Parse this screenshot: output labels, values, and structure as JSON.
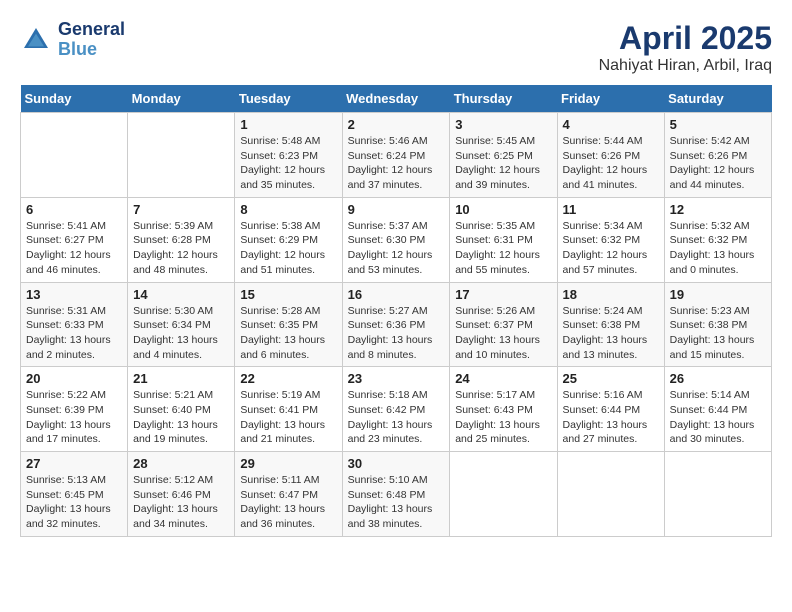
{
  "header": {
    "logo_line1": "General",
    "logo_line2": "Blue",
    "title": "April 2025",
    "subtitle": "Nahiyat Hiran, Arbil, Iraq"
  },
  "weekdays": [
    "Sunday",
    "Monday",
    "Tuesday",
    "Wednesday",
    "Thursday",
    "Friday",
    "Saturday"
  ],
  "weeks": [
    [
      {
        "day": "",
        "info": ""
      },
      {
        "day": "",
        "info": ""
      },
      {
        "day": "1",
        "info": "Sunrise: 5:48 AM\nSunset: 6:23 PM\nDaylight: 12 hours and 35 minutes."
      },
      {
        "day": "2",
        "info": "Sunrise: 5:46 AM\nSunset: 6:24 PM\nDaylight: 12 hours and 37 minutes."
      },
      {
        "day": "3",
        "info": "Sunrise: 5:45 AM\nSunset: 6:25 PM\nDaylight: 12 hours and 39 minutes."
      },
      {
        "day": "4",
        "info": "Sunrise: 5:44 AM\nSunset: 6:26 PM\nDaylight: 12 hours and 41 minutes."
      },
      {
        "day": "5",
        "info": "Sunrise: 5:42 AM\nSunset: 6:26 PM\nDaylight: 12 hours and 44 minutes."
      }
    ],
    [
      {
        "day": "6",
        "info": "Sunrise: 5:41 AM\nSunset: 6:27 PM\nDaylight: 12 hours and 46 minutes."
      },
      {
        "day": "7",
        "info": "Sunrise: 5:39 AM\nSunset: 6:28 PM\nDaylight: 12 hours and 48 minutes."
      },
      {
        "day": "8",
        "info": "Sunrise: 5:38 AM\nSunset: 6:29 PM\nDaylight: 12 hours and 51 minutes."
      },
      {
        "day": "9",
        "info": "Sunrise: 5:37 AM\nSunset: 6:30 PM\nDaylight: 12 hours and 53 minutes."
      },
      {
        "day": "10",
        "info": "Sunrise: 5:35 AM\nSunset: 6:31 PM\nDaylight: 12 hours and 55 minutes."
      },
      {
        "day": "11",
        "info": "Sunrise: 5:34 AM\nSunset: 6:32 PM\nDaylight: 12 hours and 57 minutes."
      },
      {
        "day": "12",
        "info": "Sunrise: 5:32 AM\nSunset: 6:32 PM\nDaylight: 13 hours and 0 minutes."
      }
    ],
    [
      {
        "day": "13",
        "info": "Sunrise: 5:31 AM\nSunset: 6:33 PM\nDaylight: 13 hours and 2 minutes."
      },
      {
        "day": "14",
        "info": "Sunrise: 5:30 AM\nSunset: 6:34 PM\nDaylight: 13 hours and 4 minutes."
      },
      {
        "day": "15",
        "info": "Sunrise: 5:28 AM\nSunset: 6:35 PM\nDaylight: 13 hours and 6 minutes."
      },
      {
        "day": "16",
        "info": "Sunrise: 5:27 AM\nSunset: 6:36 PM\nDaylight: 13 hours and 8 minutes."
      },
      {
        "day": "17",
        "info": "Sunrise: 5:26 AM\nSunset: 6:37 PM\nDaylight: 13 hours and 10 minutes."
      },
      {
        "day": "18",
        "info": "Sunrise: 5:24 AM\nSunset: 6:38 PM\nDaylight: 13 hours and 13 minutes."
      },
      {
        "day": "19",
        "info": "Sunrise: 5:23 AM\nSunset: 6:38 PM\nDaylight: 13 hours and 15 minutes."
      }
    ],
    [
      {
        "day": "20",
        "info": "Sunrise: 5:22 AM\nSunset: 6:39 PM\nDaylight: 13 hours and 17 minutes."
      },
      {
        "day": "21",
        "info": "Sunrise: 5:21 AM\nSunset: 6:40 PM\nDaylight: 13 hours and 19 minutes."
      },
      {
        "day": "22",
        "info": "Sunrise: 5:19 AM\nSunset: 6:41 PM\nDaylight: 13 hours and 21 minutes."
      },
      {
        "day": "23",
        "info": "Sunrise: 5:18 AM\nSunset: 6:42 PM\nDaylight: 13 hours and 23 minutes."
      },
      {
        "day": "24",
        "info": "Sunrise: 5:17 AM\nSunset: 6:43 PM\nDaylight: 13 hours and 25 minutes."
      },
      {
        "day": "25",
        "info": "Sunrise: 5:16 AM\nSunset: 6:44 PM\nDaylight: 13 hours and 27 minutes."
      },
      {
        "day": "26",
        "info": "Sunrise: 5:14 AM\nSunset: 6:44 PM\nDaylight: 13 hours and 30 minutes."
      }
    ],
    [
      {
        "day": "27",
        "info": "Sunrise: 5:13 AM\nSunset: 6:45 PM\nDaylight: 13 hours and 32 minutes."
      },
      {
        "day": "28",
        "info": "Sunrise: 5:12 AM\nSunset: 6:46 PM\nDaylight: 13 hours and 34 minutes."
      },
      {
        "day": "29",
        "info": "Sunrise: 5:11 AM\nSunset: 6:47 PM\nDaylight: 13 hours and 36 minutes."
      },
      {
        "day": "30",
        "info": "Sunrise: 5:10 AM\nSunset: 6:48 PM\nDaylight: 13 hours and 38 minutes."
      },
      {
        "day": "",
        "info": ""
      },
      {
        "day": "",
        "info": ""
      },
      {
        "day": "",
        "info": ""
      }
    ]
  ]
}
